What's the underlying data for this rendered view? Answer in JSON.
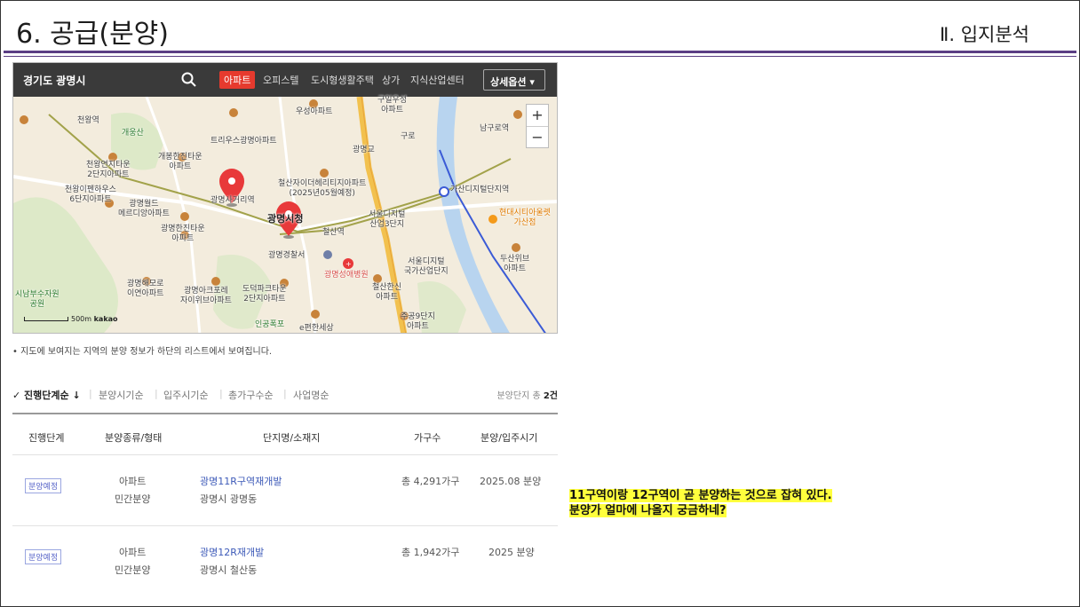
{
  "slide": {
    "title": "6. 공급(분양)",
    "section": "Ⅱ. 입지분석"
  },
  "map_panel": {
    "region": "경기도 광명시",
    "categories": [
      {
        "label": "아파트",
        "active": true
      },
      {
        "label": "오피스텔",
        "active": false
      },
      {
        "label": "도시형생활주택",
        "active": false
      },
      {
        "label": "상가",
        "active": false
      },
      {
        "label": "지식산업센터",
        "active": false
      }
    ],
    "options_label": "상세옵션",
    "zoom_in": "+",
    "zoom_out": "−",
    "scale_label": "500m",
    "provider": "kakao",
    "labels": {
      "l1": "우성아파트",
      "l2": "트리우스광명아파트",
      "l3": "천왕연지타운\n2단지아파트",
      "l4": "개봉한진타운\n아파트",
      "l5": "천왕이펜하우스\n6단지아파트",
      "l6": "광명월드\n메르디앙아파트",
      "l7": "광명한진타운\n아파트",
      "l8": "철산자이더헤리티지아파트\n(2025년05월예정)",
      "l9": "광명시청",
      "l10": "광명경찰서",
      "l11": "광명성애병원",
      "l12": "서울디지털\n산업3단지",
      "l13": "서울디지털\n국가산업단지",
      "l14": "가산디지털단지역",
      "l15": "현대시티아울렛\n가산점",
      "l16": "두산위브\n아파트",
      "l17": "광명해모로\n이연아파트",
      "l18": "광명아크포레\n자이위브아파트",
      "l19": "도덕파크타운\n2단지아파트",
      "l20": "철산한신\n아파트",
      "l21": "주공9단지\n아파트",
      "l22": "시남부수자원\n공원",
      "l23": "남구로역",
      "l24": "천왕역",
      "l25": "개웅산",
      "l26": "철산역",
      "l27": "구일우성\n아파트",
      "l28": "광명사거리역",
      "l29": "구로",
      "l30": "인공폭포",
      "l31": "e편한세상",
      "l32": "광명교"
    }
  },
  "note": "• 지도에 보여지는 지역의 분양 정보가 하단의 리스트에서 보여집니다.",
  "sort": {
    "items": [
      "✓ 진행단계순 ↓",
      "분양시기순",
      "입주시기순",
      "총가구수순",
      "사업명순"
    ],
    "total_prefix": "분양단지 총 ",
    "total_value": "2건"
  },
  "table": {
    "headers": [
      "진행단계",
      "분양종류/형태",
      "단지명/소재지",
      "가구수",
      "분양/입주시기"
    ],
    "rows": [
      {
        "stage": "분양예정",
        "type": "아파트",
        "form": "민간분양",
        "name": "광명11R구역재개발",
        "location": "광명시 광명동",
        "households": "총 4,291가구",
        "period": "2025.08 분양"
      },
      {
        "stage": "분양예정",
        "type": "아파트",
        "form": "민간분양",
        "name": "광명12R재개발",
        "location": "광명시 철산동",
        "households": "총 1,942가구",
        "period": "2025 분양"
      }
    ]
  },
  "callout": {
    "line1": "11구역이랑 12구역이 곧 분양하는 것으로 잡혀 있다.",
    "line2": "분양가 얼마에 나올지 궁금하네?"
  },
  "colors": {
    "accent_rule": "#5b3f84",
    "active_category": "#e63a2e",
    "highlight": "#ffff3d",
    "link": "#3d5ab8",
    "marker": "#e8393a"
  }
}
